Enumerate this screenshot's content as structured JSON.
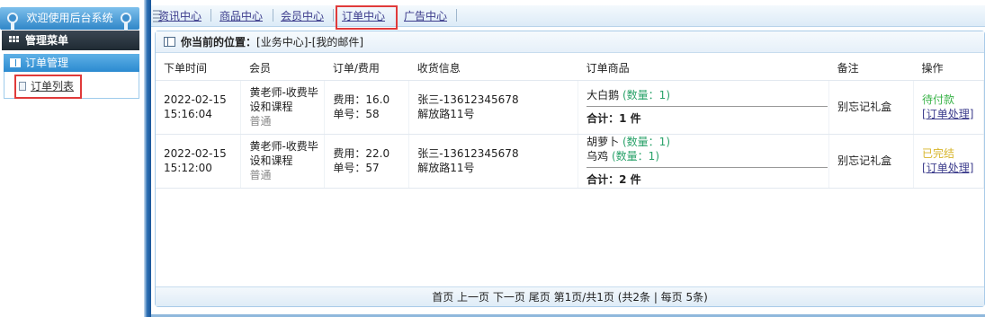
{
  "sidebar": {
    "welcome": "欢迎使用后台系统",
    "menu_title": "管理菜单",
    "group_title": "订单管理",
    "item_label": "订单列表"
  },
  "tabs": [
    {
      "label": "资讯中心"
    },
    {
      "label": "商品中心"
    },
    {
      "label": "会员中心"
    },
    {
      "label": "订单中心",
      "active": true
    },
    {
      "label": "广告中心"
    }
  ],
  "location": {
    "prefix": "你当前的位置：",
    "path": "[业务中心]-[我的邮件]"
  },
  "table": {
    "headers": [
      "下单时间",
      "会员",
      "订单/费用",
      "收货信息",
      "订单商品",
      "备注",
      "操作"
    ],
    "rows": [
      {
        "date": "2022-02-15",
        "time": "15:16:04",
        "member_name": "黄老师-收费毕设和课程",
        "member_level": "普通",
        "fee": "费用：16.0",
        "order_no": "单号：58",
        "receiver": "张三-13612345678",
        "address": "解放路11号",
        "goods": [
          {
            "name": "大白鹅",
            "qty": "(数量：1)"
          }
        ],
        "total": "合计：1 件",
        "remark": "别忘记礼盒",
        "status": "待付款",
        "action": "[订单处理]"
      },
      {
        "date": "2022-02-15",
        "time": "15:12:00",
        "member_name": "黄老师-收费毕设和课程",
        "member_level": "普通",
        "fee": "费用：22.0",
        "order_no": "单号：57",
        "receiver": "张三-13612345678",
        "address": "解放路11号",
        "goods": [
          {
            "name": "胡萝卜",
            "qty": "(数量：1)"
          },
          {
            "name": "乌鸡",
            "qty": "(数量：1)"
          }
        ],
        "total": "合计：2 件",
        "remark": "别忘记礼盒",
        "status": "已完结",
        "action": "[订单处理]"
      }
    ]
  },
  "pager": {
    "first": "首页",
    "prev": "上一页",
    "next": "下一页",
    "last": "尾页",
    "info": "第1页/共1页 (共2条 | 每页 5条)"
  },
  "colors": {
    "status_pending": "#3bb44a",
    "status_done": "#d7b52a",
    "highlight_box": "#e03a3a"
  }
}
